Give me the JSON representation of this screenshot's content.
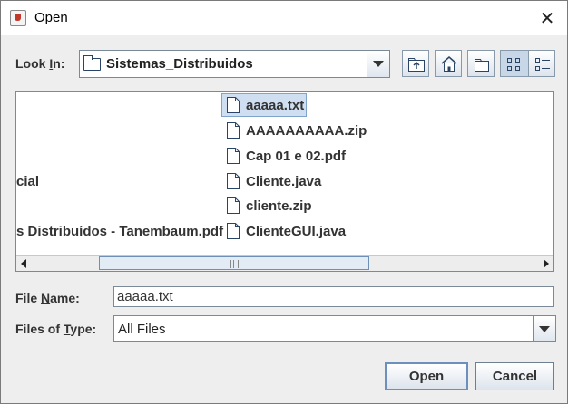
{
  "window": {
    "title": "Open",
    "close_glyph": "✕",
    "icon": "java-cup-icon"
  },
  "look_in": {
    "label_prefix": "Look ",
    "label_mnemonic": "I",
    "label_suffix": "n:",
    "value": "Sistemas_Distribuidos",
    "icon": "folder-icon"
  },
  "toolbar": {
    "buttons": [
      {
        "name": "up-one-level-button",
        "icon": "folder-up-icon"
      },
      {
        "name": "home-button",
        "icon": "home-icon"
      },
      {
        "name": "new-folder-button",
        "icon": "new-folder-icon"
      },
      {
        "name": "list-view-button",
        "icon": "list-view-icon",
        "active": true
      },
      {
        "name": "details-view-button",
        "icon": "details-view-icon"
      }
    ]
  },
  "file_list": {
    "left_column": [
      "",
      "",
      "",
      "cial",
      "",
      "s Distribuídos - Tanembaum.pdf"
    ],
    "right_column": [
      {
        "name": "aaaaa.txt",
        "selected": true
      },
      {
        "name": "AAAAAAAAAA.zip"
      },
      {
        "name": "Cap 01 e 02.pdf"
      },
      {
        "name": "Cliente.java"
      },
      {
        "name": "cliente.zip"
      },
      {
        "name": "ClienteGUI.java"
      }
    ]
  },
  "file_name": {
    "label_prefix": "File ",
    "label_mnemonic": "N",
    "label_suffix": "ame:",
    "value": "aaaaa.txt"
  },
  "files_of_type": {
    "label_prefix": "Files of ",
    "label_mnemonic": "T",
    "label_suffix": "ype:",
    "value": "All Files"
  },
  "buttons": {
    "open": "Open",
    "cancel": "Cancel"
  },
  "colors": {
    "selection": "#cfdff1",
    "selection_border": "#7ea4c9",
    "window_bg": "#eeeeee"
  }
}
